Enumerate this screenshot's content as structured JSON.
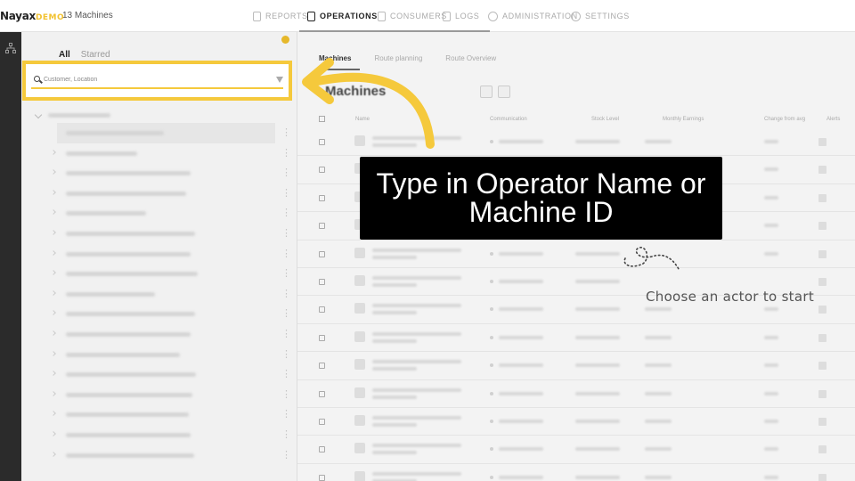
{
  "app": {
    "brand": "Nayax",
    "brand_suffix": "DEMO",
    "machine_count": "13 Machines"
  },
  "nav": {
    "items": [
      {
        "label": "REPORTS",
        "icon": "report-icon",
        "active": false
      },
      {
        "label": "OPERATIONS",
        "icon": "operations-icon",
        "active": true
      },
      {
        "label": "CONSUMERS",
        "icon": "consumers-icon",
        "active": false
      },
      {
        "label": "LOGS",
        "icon": "logs-icon",
        "active": false
      },
      {
        "label": "ADMINISTRATION",
        "icon": "administration-icon",
        "active": false
      },
      {
        "label": "SETTINGS",
        "icon": "settings-icon",
        "active": false
      }
    ]
  },
  "sidebar": {
    "tabs": {
      "all": "All",
      "starred": "Starred"
    },
    "search": {
      "placeholder": "Customer, Location",
      "value": ""
    }
  },
  "main": {
    "tabs": {
      "machines": "Machines",
      "route_planning": "Route planning",
      "route_overview": "Route Overview"
    },
    "title": "Machines",
    "columns": {
      "name": "Name",
      "communication": "Communication",
      "stock_level": "Stock Level",
      "monthly_earnings": "Monthly Earnings",
      "change_from_avg": "Change from avg",
      "alerts": "Alerts"
    }
  },
  "overlay": {
    "callout_line1": "Type in Operator Name or",
    "callout_line2": "Machine ID",
    "actor_hint": "Choose an actor to start"
  },
  "colors": {
    "accent": "#f5c93c",
    "callout_bg": "#000000",
    "rail": "#2b2b2b"
  }
}
